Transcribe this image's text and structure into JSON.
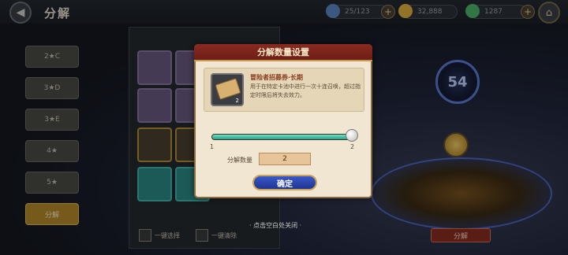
{
  "header": {
    "title": "分解",
    "resources": [
      {
        "value": "25/123",
        "icon": "gem-icon",
        "color": "#5b87c7"
      },
      {
        "value": "32,888",
        "icon": "gold-coin-icon",
        "color": "#e0b33f"
      },
      {
        "value": "1287",
        "icon": "green-crystal-icon",
        "color": "#4db56b"
      }
    ]
  },
  "sidebar": {
    "filters": [
      {
        "label": "2★C"
      },
      {
        "label": "3★D"
      },
      {
        "label": "3★E"
      },
      {
        "label": "4★"
      },
      {
        "label": "5★"
      },
      {
        "label": "分解",
        "active": true
      }
    ]
  },
  "bottom_bar": {
    "select_all": "一键选择",
    "clear": "一键清除"
  },
  "right_panel": {
    "level": "54",
    "action_button": "分解"
  },
  "dialog": {
    "title": "分解数量设置",
    "item": {
      "name": "冒险者招募券·长期",
      "count": "2",
      "description": "用于在特定卡池中进行一次十连召唤，超过指定时限后将失去效力。"
    },
    "slider": {
      "min": "1",
      "max": "2",
      "fraction": 1.0
    },
    "quantity_label": "分解数量",
    "quantity_value": "2",
    "confirm_label": "确定"
  },
  "close_hint": "· 点击空白处关闭 ·"
}
